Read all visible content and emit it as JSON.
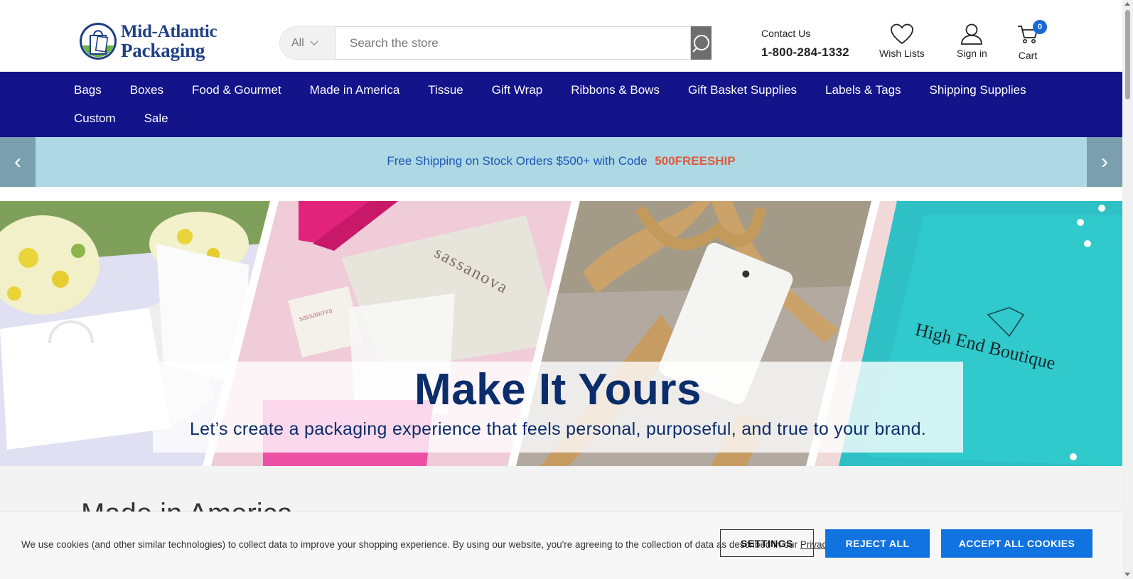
{
  "header": {
    "logo": {
      "line1": "Mid-Atlantic",
      "line2": "Packaging",
      "icon": "shopping-bag-logo-icon"
    },
    "search": {
      "category": "All",
      "placeholder": "Search the store",
      "icon": "search-icon"
    },
    "contact": {
      "label": "Contact Us",
      "phone": "1-800-284-1332"
    },
    "wishlist": {
      "label": "Wish Lists",
      "icon": "heart-icon"
    },
    "signin": {
      "label": "Sign in",
      "icon": "user-icon"
    },
    "cart": {
      "label": "Cart",
      "count": "0",
      "icon": "cart-icon"
    }
  },
  "nav": {
    "row1": [
      "Bags",
      "Boxes",
      "Food & Gourmet",
      "Made in America",
      "Tissue",
      "Gift Wrap",
      "Ribbons & Bows",
      "Gift Basket Supplies",
      "Labels & Tags",
      "Shipping Supplies"
    ],
    "row2": [
      "Custom",
      "Sale"
    ]
  },
  "promo": {
    "text": "Free Shipping on Stock Orders $500+ with Code",
    "code": "500FREESHIP",
    "prev": "‹",
    "next": "›"
  },
  "hero": {
    "title": "Make It Yours",
    "subtitle": "Let’s create a packaging experience that feels personal, purposeful, and true to your brand.",
    "panel_brands": [
      "sassanova",
      "sassanova",
      "High End Boutique"
    ]
  },
  "section": {
    "title": "Made in America"
  },
  "cookie": {
    "text": "We use cookies (and other similar technologies) to collect data to improve your shopping experience. By using our website, you're agreeing to the collection of data as described in our",
    "link": "Privacy Policy",
    "settings": "SETTINGS",
    "reject": "REJECT ALL",
    "accept": "ACCEPT ALL COOKIES"
  },
  "colors": {
    "nav_bg": "#13138a",
    "promo_bg": "#add8e4",
    "promo_text": "#1e56b8",
    "promo_code": "#e05a3c",
    "hero_title": "#0b2d6b",
    "cookie_buttons": "#1173e0",
    "cart_badge": "#1769d4"
  }
}
